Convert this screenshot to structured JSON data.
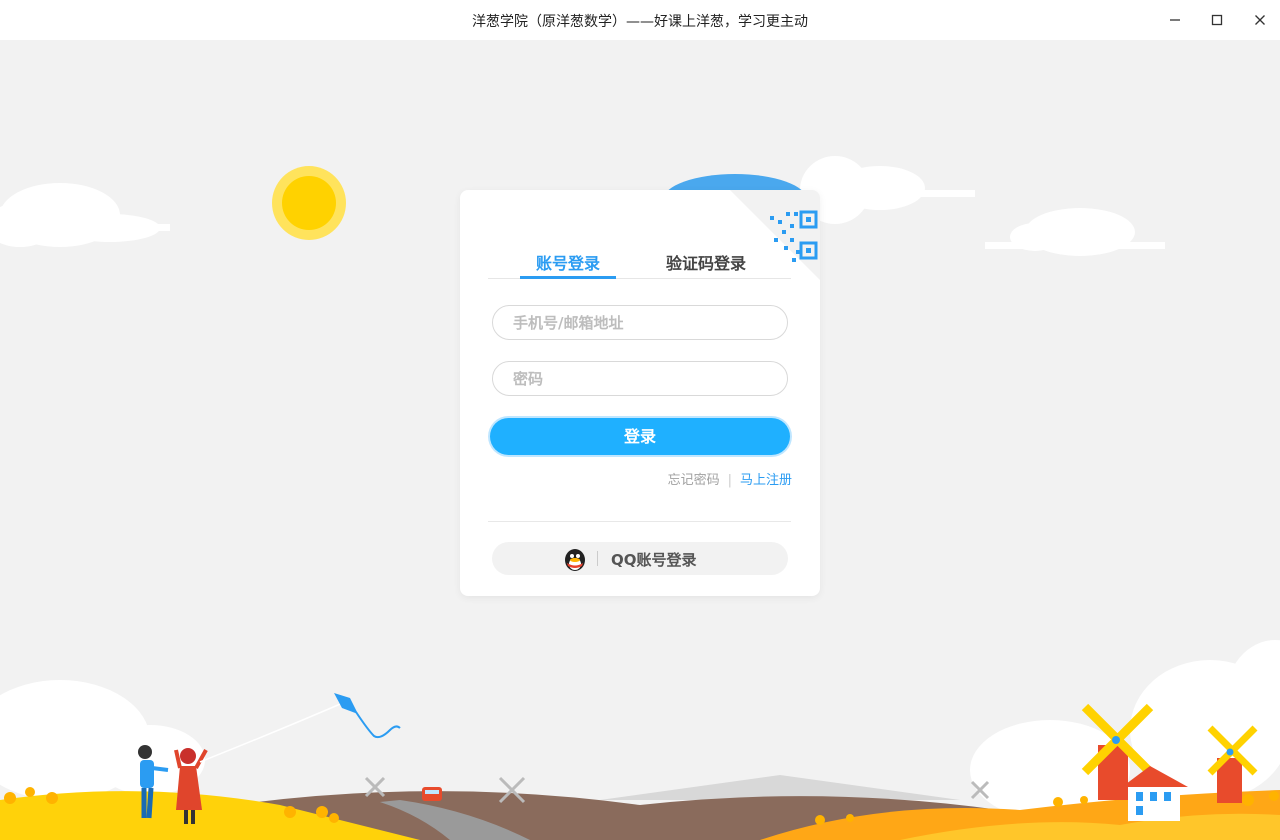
{
  "window": {
    "title": "洋葱学院（原洋葱数学）——好课上洋葱，学习更主动",
    "controls": [
      "minimize-icon",
      "maximize-icon",
      "close-icon"
    ]
  },
  "login": {
    "tabs": [
      {
        "label": "账号登录",
        "active": true
      },
      {
        "label": "验证码登录",
        "active": false
      }
    ],
    "account_placeholder": "手机号/邮箱地址",
    "account_value": "",
    "password_placeholder": "密码",
    "password_value": "",
    "submit_label": "登录",
    "forgot_label": "忘记密码",
    "separator": "|",
    "register_label": "马上注册",
    "qq_label": "QQ账号登录",
    "qr_icon": "qr-code-icon"
  },
  "colors": {
    "accent": "#2b9cf2",
    "button": "#1fb0ff",
    "background": "#f2f2f2",
    "sun": "#ffd200",
    "hills": "#ffc107"
  }
}
